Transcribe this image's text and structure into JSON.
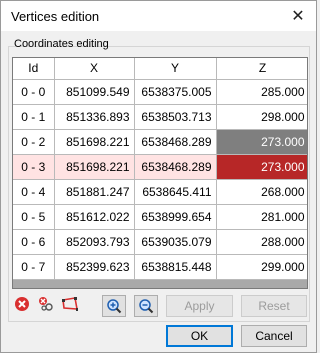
{
  "window": {
    "title": "Vertices edition"
  },
  "group": {
    "label": "Coordinates editing"
  },
  "table": {
    "columns": [
      "Id",
      "X",
      "Y",
      "Z"
    ],
    "rows": [
      [
        "0 - 0",
        "851099.549",
        "6538375.005",
        "285.000"
      ],
      [
        "0 - 1",
        "851336.893",
        "6538503.713",
        "298.000"
      ],
      [
        "0 - 2",
        "851698.221",
        "6538468.289",
        "273.000"
      ],
      [
        "0 - 3",
        "851698.221",
        "6538468.289",
        "273.000"
      ],
      [
        "0 - 4",
        "851881.247",
        "6538645.411",
        "268.000"
      ],
      [
        "0 - 5",
        "851612.022",
        "6538999.654",
        "281.000"
      ],
      [
        "0 - 6",
        "852093.793",
        "6539035.079",
        "288.000"
      ],
      [
        "0 - 7",
        "852399.623",
        "6538815.448",
        "299.000"
      ]
    ]
  },
  "toolbar": {
    "apply_label": "Apply",
    "reset_label": "Reset"
  },
  "footer": {
    "ok_label": "OK",
    "cancel_label": "Cancel"
  },
  "colors": {
    "duplicate_gray": "#7f7f7f",
    "duplicate_red": "#b72727",
    "selected_row": "#ffe3e3",
    "accent": "#0078d7"
  }
}
